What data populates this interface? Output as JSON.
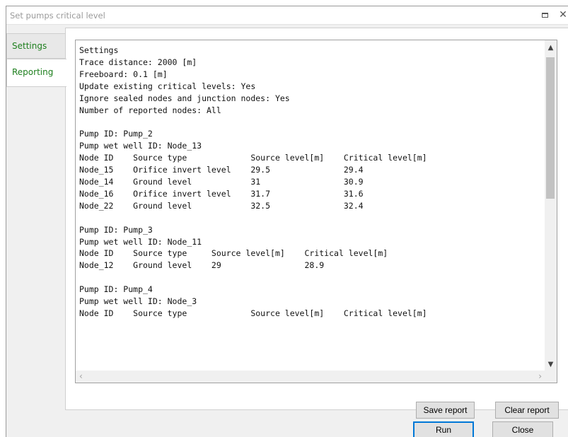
{
  "window": {
    "title": "Set pumps critical level"
  },
  "tabs": {
    "settings": "Settings",
    "reporting": "Reporting"
  },
  "report": {
    "lines": [
      "Settings",
      "Trace distance: 2000 [m]",
      "Freeboard: 0.1 [m]",
      "Update existing critical levels: Yes",
      "Ignore sealed nodes and junction nodes: Yes",
      "Number of reported nodes: All",
      "",
      "Pump ID: Pump_2",
      "Pump wet well ID: Node_13",
      "Node ID    Source type             Source level[m]    Critical level[m]",
      "Node_15    Orifice invert level    29.5               29.4",
      "Node_14    Ground level            31                 30.9",
      "Node_16    Orifice invert level    31.7               31.6",
      "Node_22    Ground level            32.5               32.4",
      "",
      "Pump ID: Pump_3",
      "Pump wet well ID: Node_11",
      "Node ID    Source type     Source level[m]    Critical level[m]",
      "Node_12    Ground level    29                 28.9",
      "",
      "Pump ID: Pump_4",
      "Pump wet well ID: Node_3",
      "Node ID    Source type             Source level[m]    Critical level[m]"
    ]
  },
  "buttons": {
    "save_report": "Save report",
    "clear_report": "Clear report",
    "run": "Run",
    "close": "Close"
  }
}
